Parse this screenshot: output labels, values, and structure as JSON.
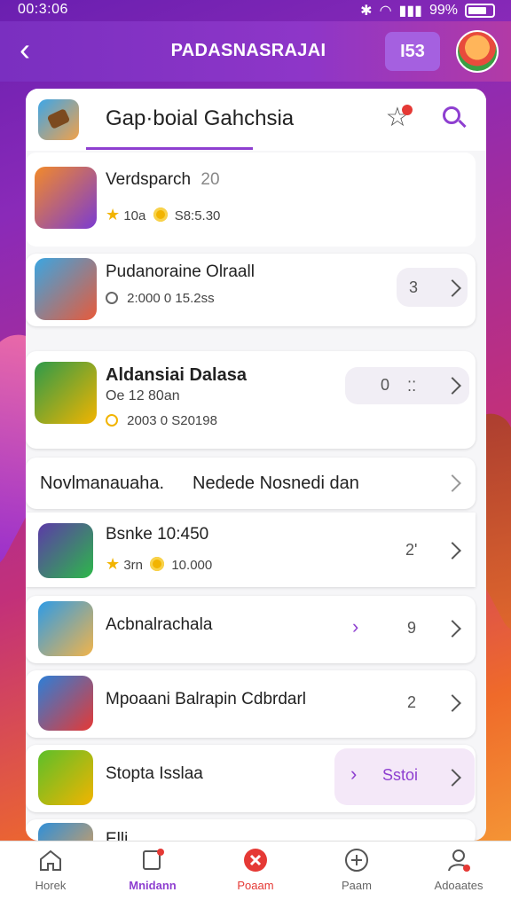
{
  "status_bar": {
    "time": "00:3:06",
    "battery": "99%"
  },
  "header": {
    "title": "PADASNASRAJAI",
    "action_button": "I53"
  },
  "card": {
    "title": "Gap·boial Gahchsia"
  },
  "items": [
    {
      "name": "Verdsparch",
      "name_suffix": "20",
      "meta1": "10a",
      "meta2": "S8:5.30"
    },
    {
      "name": "Pudanoraine Olraall",
      "meta": "2:000 0 15.2ss",
      "count": "3"
    },
    {
      "name": "Aldansiai Dalasa",
      "sub": "Oe 12 80an",
      "meta": "2003 0  S20198",
      "count": "0"
    }
  ],
  "section": {
    "left": "Novlmanauaha.",
    "right": "Nedede Nosnedi dan"
  },
  "list": [
    {
      "name": "Bsnke 10:450",
      "meta1": "3rn",
      "meta2": "10.000",
      "count": "2'"
    },
    {
      "name": "Acbnalrachala",
      "count": "9"
    },
    {
      "name": "Mpoaani Balrapin Cdbrdarl",
      "count": "2"
    },
    {
      "name": "Stopta Isslaa",
      "action": "Sstoi"
    },
    {
      "name": "Elli..."
    }
  ],
  "bottom_nav": [
    {
      "label": "Horek"
    },
    {
      "label": "Mnidann"
    },
    {
      "label": "Poaam"
    },
    {
      "label": "Paam"
    },
    {
      "label": "Adoaates"
    }
  ],
  "colors": {
    "accent": "#8e3fd0",
    "active_nav": "#e53935"
  }
}
